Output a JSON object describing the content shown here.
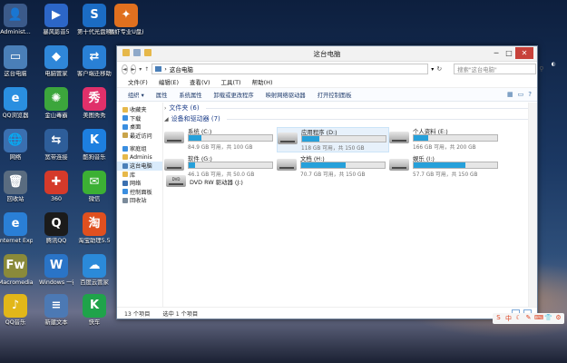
{
  "desktop": {
    "icons": [
      {
        "label": "Administ...",
        "glyph": "👤",
        "color": "#3b5a8a"
      },
      {
        "label": "暴风影音5",
        "glyph": "▶",
        "color": "#2c66c7"
      },
      {
        "label": "第十代光盘映射2014...",
        "glyph": "S",
        "color": "#1b6cc4"
      },
      {
        "label": "播虾专业U盘启动器",
        "glyph": "✦",
        "color": "#e0701f"
      },
      {
        "label": "这台电脑",
        "glyph": "▭",
        "color": "#4a7fb8"
      },
      {
        "label": "电脑管家",
        "glyph": "◆",
        "color": "#2f87d9"
      },
      {
        "label": "客户端迁移助手V1.0",
        "glyph": "⇄",
        "color": "#2980d6"
      },
      {
        "label": "QQ浏览器",
        "glyph": "e",
        "color": "#2a8fe0"
      },
      {
        "label": "金山毒霸",
        "glyph": "✺",
        "color": "#3ca63c"
      },
      {
        "label": "美图秀秀",
        "glyph": "秀",
        "color": "#e0306a"
      },
      {
        "label": "网络",
        "glyph": "🌐",
        "color": "#3a6fb0"
      },
      {
        "label": "宽带连接",
        "glyph": "⇆",
        "color": "#2e5e9a"
      },
      {
        "label": "酷狗音乐",
        "glyph": "K",
        "color": "#1d7fe0"
      },
      {
        "label": "回收站",
        "glyph": "🗑",
        "color": "#5a6c80"
      },
      {
        "label": "360",
        "glyph": "✚",
        "color": "#d53a2a"
      },
      {
        "label": "微信",
        "glyph": "✉",
        "color": "#3cb034"
      },
      {
        "label": "Internet Explorer",
        "glyph": "e",
        "color": "#2a7fd6"
      },
      {
        "label": "腾讯QQ",
        "glyph": "Q",
        "color": "#1b1b1b"
      },
      {
        "label": "淘宝助理5.5",
        "glyph": "淘",
        "color": "#e0501f"
      },
      {
        "label": "Macromedia Fireworks 8",
        "glyph": "Fw",
        "color": "#8a8a3a"
      },
      {
        "label": "Windows 一键还原",
        "glyph": "W",
        "color": "#2a74c7"
      },
      {
        "label": "百度云管家",
        "glyph": "☁",
        "color": "#2b8ad9"
      },
      {
        "label": "QQ音乐",
        "glyph": "♪",
        "color": "#e2b719"
      },
      {
        "label": "新建文本",
        "glyph": "≡",
        "color": "#4c79b4"
      },
      {
        "label": "快车",
        "glyph": "K",
        "color": "#1fa34a"
      }
    ]
  },
  "window": {
    "title": "这台电脑",
    "window_buttons": {
      "minimize": "─",
      "maximize": "□",
      "close": "✕"
    },
    "menu": [
      "文件(F)",
      "编辑(E)",
      "查看(V)",
      "工具(T)",
      "帮助(H)"
    ],
    "address": {
      "path": "这台电脑",
      "search_placeholder": "搜索\"这台电脑\""
    },
    "nav": {
      "back": "◄",
      "forward": "►",
      "up": "↑"
    },
    "toolbar": [
      "组织 ▾",
      "属性",
      "系统属性",
      "卸载或更改程序",
      "映射网络驱动器",
      "打开控制面板"
    ],
    "sidebar": [
      {
        "label": "收藏夹",
        "color": "#e6b84a"
      },
      {
        "label": "下载",
        "color": "#3a8ee0"
      },
      {
        "label": "桌面",
        "color": "#3a8ee0"
      },
      {
        "label": "最近访问",
        "color": "#c9a44a"
      },
      {
        "gap": true
      },
      {
        "label": "家庭组",
        "color": "#3a8ee0"
      },
      {
        "label": "Adminis",
        "color": "#e6b84a"
      },
      {
        "label": "这台电脑",
        "color": "#4a7fb8",
        "selected": true
      },
      {
        "label": "库",
        "color": "#e6b84a"
      },
      {
        "label": "网络",
        "color": "#3a6fb0"
      },
      {
        "label": "控制面板",
        "color": "#3a8ee0"
      },
      {
        "label": "回收站",
        "color": "#7a8a9a"
      }
    ],
    "groups": {
      "folders": "文件夹 (6)",
      "drives": "设备和驱动器 (7)"
    },
    "drives": [
      {
        "name": "系统 (C:)",
        "size": "84.9 GB 可用，共 100 GB",
        "used": 0.15
      },
      {
        "name": "应用程序 (D:)",
        "size": "118 GB 可用，共 150 GB",
        "used": 0.21,
        "selected": true
      },
      {
        "name": "个人资料 (E:)",
        "size": "166 GB 可用，共 200 GB",
        "used": 0.17
      },
      {
        "name": "软件 (G:)",
        "size": "46.1 GB 可用，共 50.0 GB",
        "used": 0.08
      },
      {
        "name": "文档 (H:)",
        "size": "70.7 GB 可用，共 150 GB",
        "used": 0.53
      },
      {
        "name": "娱乐 (I:)",
        "size": "57.7 GB 可用，共 150 GB",
        "used": 0.62
      }
    ],
    "dvd": {
      "name": "DVD RW 驱动器 (J:)",
      "icon_label": "DVD"
    },
    "status": {
      "count": "13 个项目",
      "selected": "选中 1 个项目"
    }
  },
  "tray": [
    "S",
    "中",
    "☾",
    "✎",
    "⌨",
    "👕",
    "⚙"
  ]
}
